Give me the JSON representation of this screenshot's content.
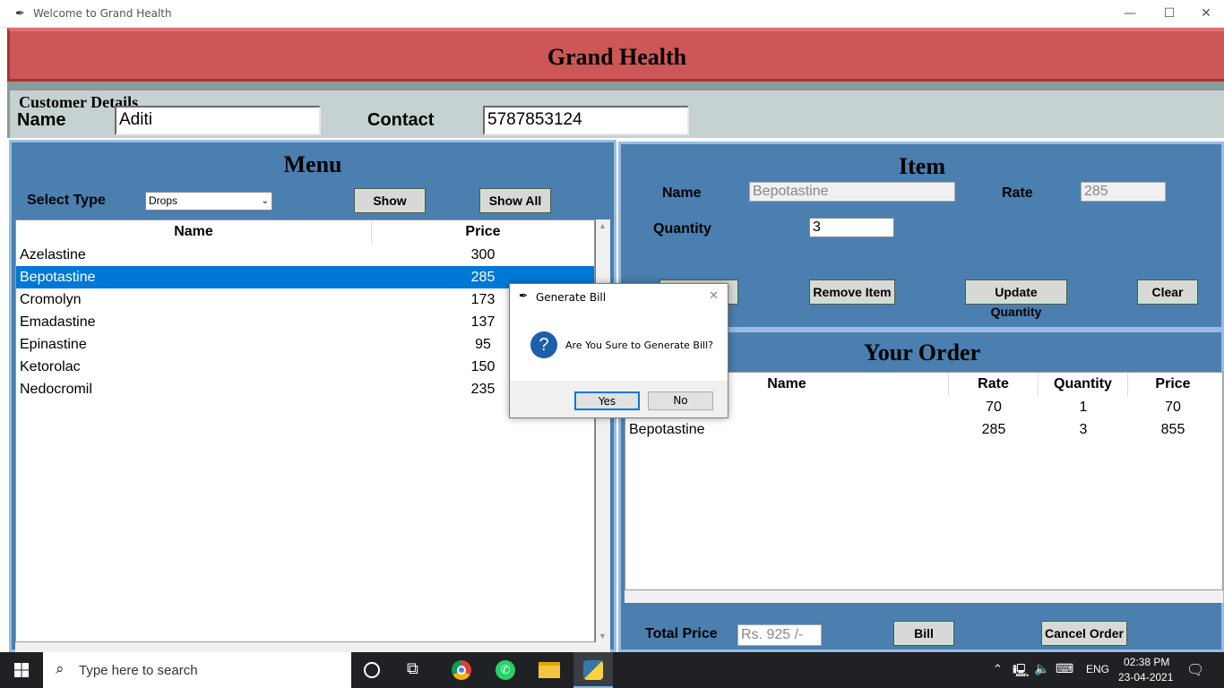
{
  "window": {
    "title": "Welcome to Grand Health",
    "minimize": "—",
    "maximize": "☐",
    "close": "✕"
  },
  "header": {
    "title": "Grand Health"
  },
  "customer": {
    "legend": "Customer Details",
    "name_label": "Name",
    "name_value": "Aditi",
    "contact_label": "Contact",
    "contact_value": "5787853124"
  },
  "menu": {
    "title": "Menu",
    "select_type_label": "Select Type",
    "select_type_value": "Drops",
    "show_label": "Show",
    "show_all_label": "Show All",
    "columns": [
      "Name",
      "Price"
    ],
    "rows": [
      {
        "name": "Azelastine",
        "price": "300"
      },
      {
        "name": "Bepotastine",
        "price": "285"
      },
      {
        "name": "Cromolyn",
        "price": "173"
      },
      {
        "name": "Emadastine",
        "price": "137"
      },
      {
        "name": "Epinastine",
        "price": "95"
      },
      {
        "name": "Ketorolac",
        "price": "150"
      },
      {
        "name": "Nedocromil",
        "price": "235"
      }
    ],
    "selected_index": 1
  },
  "item": {
    "title": "Item",
    "name_label": "Name",
    "name_value": "Bepotastine",
    "rate_label": "Rate",
    "rate_value": "285",
    "quantity_label": "Quantity",
    "quantity_value": "3",
    "remove_label": "Remove Item",
    "update_label": "Update Quantity",
    "clear_label": "Clear"
  },
  "order": {
    "title": "Your Order",
    "columns": [
      "Name",
      "Rate",
      "Quantity",
      "Price"
    ],
    "rows": [
      {
        "name": "",
        "rate": "70",
        "qty": "1",
        "price": "70"
      },
      {
        "name": "Bepotastine",
        "rate": "285",
        "qty": "3",
        "price": "855"
      }
    ],
    "total_label": "Total Price",
    "total_value": "Rs. 925  /-",
    "bill_label": "Bill",
    "cancel_label": "Cancel Order"
  },
  "dialog": {
    "title": "Generate Bill",
    "message": "Are You Sure to Generate Bill?",
    "yes_label": "Yes",
    "no_label": "No"
  },
  "taskbar": {
    "search_placeholder": "Type here to search",
    "lang": "ENG",
    "time": "02:38 PM",
    "date": "23-04-2021"
  },
  "colors": {
    "accent": "#0078d7",
    "panel": "#4a7fb0",
    "header": "#cd5656"
  }
}
